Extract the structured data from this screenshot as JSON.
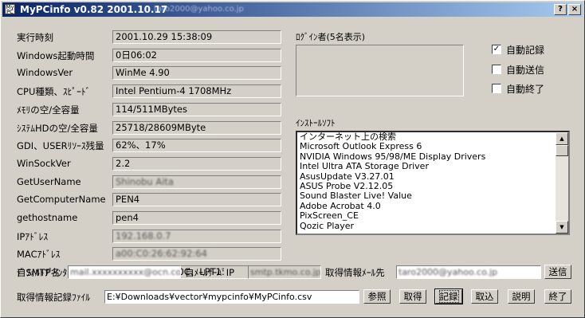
{
  "window": {
    "title": "MyPCinfo v0.82 2001.10.17",
    "title_email": "taro2000@yahoo.co.jp",
    "icon_label": "My PC"
  },
  "info": [
    {
      "label": "実行時刻",
      "value": "2001.10.29 15:38:09"
    },
    {
      "label": "Windows起動時間",
      "value": "0日06:02"
    },
    {
      "label": "WindowsVer",
      "value": "WinMe 4.90"
    },
    {
      "label": "CPU種類、ｽﾋﾟｰﾄﾞ",
      "value": "Intel Pentium-4 1708MHz"
    },
    {
      "label": "ﾒﾓﾘの空/全容量",
      "value": "114/511MBytes"
    },
    {
      "label": "ｼｽﾃﾑHDの空/全容量",
      "value": "25718/28609MByte"
    },
    {
      "label": "GDI、USERﾘｿｰｽ残量",
      "value": "62%、17%"
    },
    {
      "label": "WinSockVer",
      "value": "2.2"
    },
    {
      "label": "GetUserName",
      "value": "Shinobu Aita"
    },
    {
      "label": "GetComputerName",
      "value": "PEN4"
    },
    {
      "label": "gethostname",
      "value": "pen4"
    },
    {
      "label": "IPｱﾄﾞﾚｽ",
      "value": "192.168.0.7"
    },
    {
      "label": "MACｱﾄﾞﾚｽ",
      "value": "a00:C0:26:62:92:64"
    },
    {
      "label": "ﾃﾞﾌｫﾙﾄﾌﾟﾘﾝﾀ、ﾎﾟｰﾄ",
      "value": "EPSON PM-880C、LPT1:"
    }
  ],
  "login": {
    "label": "ﾛｸﾞｲﾝ者(5名表示)"
  },
  "options": [
    {
      "label": "自動記録",
      "checked": true,
      "mark": "✓"
    },
    {
      "label": "自動送信",
      "checked": false,
      "mark": ""
    },
    {
      "label": "自動終了",
      "checked": false,
      "mark": ""
    }
  ],
  "software": {
    "label": "ｲﾝｽﾄｰﾙｿﾌﾄ",
    "items": [
      "インターネット上の検索",
      "Microsoft Outlook Express 6",
      "NVIDIA Windows 95/98/ME Display Drivers",
      "Intel Ultra ATA Storage Driver",
      "AsusUpdate V3.27.01",
      "ASUS Probe V2.12.05",
      "Sound Blaster Live! Value",
      "Adobe Acrobat 4.0",
      "PixScreen_CE",
      "Qozic Player"
    ]
  },
  "mail": {
    "smtp_label": "自SMTP名",
    "smtp_value": "mail.xxxxxxxxxx@ocn.co.jp",
    "server_ip_label": "自ﾒｰﾙｻｰﾊﾞIP",
    "server_ip_value": "smtp.tkmo.co.jp",
    "dest_label": "取得情報ﾒｰﾙ先",
    "dest_value": "taro2000@yahoo.co.jp",
    "send_button": "送信"
  },
  "record": {
    "label": "取得情報記録ﾌｧｲﾙ",
    "path": "E:¥Downloads¥vector¥mypcinfo¥MyPCinfo.csv",
    "buttons": {
      "browse": "参照",
      "get": "取得",
      "record": "記録",
      "import": "取込",
      "help": "説明",
      "exit": "終了"
    }
  },
  "scroll": {
    "up_icon": "▲",
    "down_icon": "▼"
  },
  "titlebar_buttons": {
    "help": "?",
    "close": "×"
  }
}
